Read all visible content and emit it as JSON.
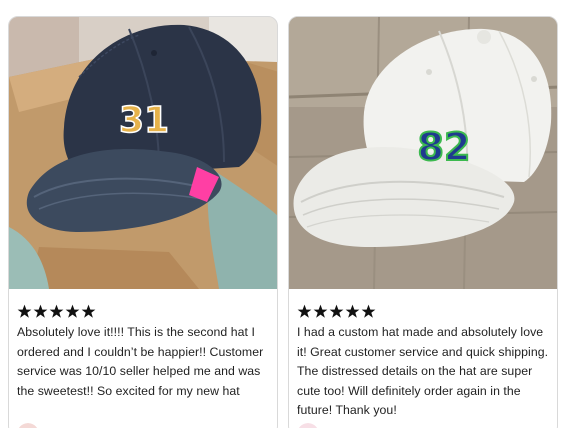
{
  "reviews": [
    {
      "rating": 5,
      "cap_number": "31",
      "text": "Absolutely love it!!!! This is the second hat I ordered and I couldn’t be happier!! Customer service was 10/10 seller helped me and was the sweetest!! So excited for my new hat",
      "colors": {
        "cap": "#2b3447",
        "number_fill": "#e6b24a",
        "tag": "#ff3fa4"
      }
    },
    {
      "rating": 5,
      "cap_number": "82",
      "text": "I had a custom hat made and absolutely love it! Great customer service and quick shipping. The distressed details on the hat are super cute too! Will definitely order again in the future! Thank you!",
      "colors": {
        "cap": "#f2f2ef",
        "number_fill": "#1f3a8f",
        "number_outline": "#3cb94f"
      }
    }
  ],
  "colors": {
    "star": "#111111",
    "text": "#222222",
    "card_border": "#d9d9d9"
  }
}
